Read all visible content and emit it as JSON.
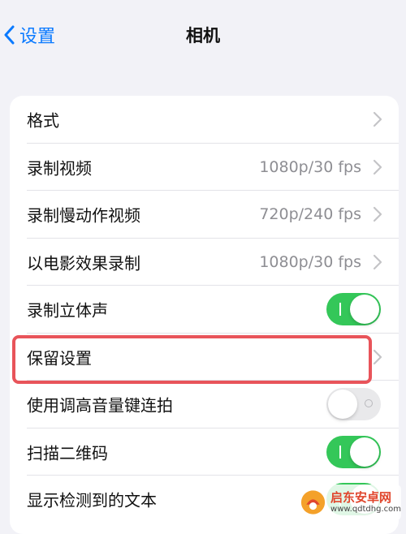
{
  "nav": {
    "back_label": "设置",
    "title": "相机"
  },
  "rows": [
    {
      "label": "格式",
      "type": "link",
      "value": ""
    },
    {
      "label": "录制视频",
      "type": "link",
      "value": "1080p/30 fps"
    },
    {
      "label": "录制慢动作视频",
      "type": "link",
      "value": "720p/240 fps"
    },
    {
      "label": "以电影效果录制",
      "type": "link",
      "value": "1080p/30 fps"
    },
    {
      "label": "录制立体声",
      "type": "toggle",
      "on": true
    },
    {
      "label": "保留设置",
      "type": "link",
      "value": "",
      "highlighted": true
    },
    {
      "label": "使用调高音量键连拍",
      "type": "toggle",
      "on": false
    },
    {
      "label": "扫描二维码",
      "type": "toggle",
      "on": true
    },
    {
      "label": "显示检测到的文本",
      "type": "toggle",
      "on": true
    }
  ],
  "colors": {
    "accent": "#0a7aff",
    "switch_on": "#34c759",
    "highlight": "#e8545a",
    "background": "#f2f2f7"
  },
  "watermark": {
    "title": "启东安卓网",
    "url": "www.qdtdhg.com"
  }
}
